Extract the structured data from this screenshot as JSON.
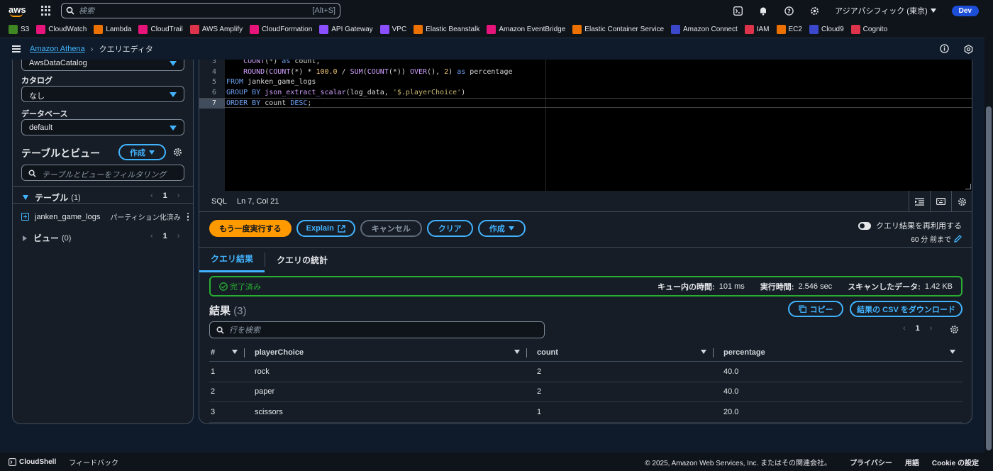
{
  "topnav": {
    "logo": "aws",
    "search_placeholder": "検索",
    "search_shortcut": "[Alt+S]",
    "region": "アジアパシフィック (東京)",
    "account_badge": "Dev"
  },
  "favorites": [
    {
      "label": "S3",
      "color": "#3f8624"
    },
    {
      "label": "CloudWatch",
      "color": "#e7157b"
    },
    {
      "label": "Lambda",
      "color": "#ed7100"
    },
    {
      "label": "CloudTrail",
      "color": "#e7157b"
    },
    {
      "label": "AWS Amplify",
      "color": "#dd344c"
    },
    {
      "label": "CloudFormation",
      "color": "#e7157b"
    },
    {
      "label": "API Gateway",
      "color": "#8c4fff"
    },
    {
      "label": "VPC",
      "color": "#8c4fff"
    },
    {
      "label": "Elastic Beanstalk",
      "color": "#ed7100"
    },
    {
      "label": "Amazon EventBridge",
      "color": "#e7157b"
    },
    {
      "label": "Elastic Container Service",
      "color": "#ed7100"
    },
    {
      "label": "Amazon Connect",
      "color": "#3b48cc"
    },
    {
      "label": "IAM",
      "color": "#dd344c"
    },
    {
      "label": "EC2",
      "color": "#ed7100"
    },
    {
      "label": "Cloud9",
      "color": "#3b48cc"
    },
    {
      "label": "Cognito",
      "color": "#dd344c"
    }
  ],
  "breadcrumb": {
    "service": "Amazon Athena",
    "current": "クエリエディタ"
  },
  "left": {
    "datasource_value": "AwsDataCatalog",
    "catalog_label": "カタログ",
    "catalog_value": "なし",
    "database_label": "データベース",
    "database_value": "default",
    "tables_views_title": "テーブルとビュー",
    "create_label": "作成",
    "filter_placeholder": "テーブルとビューをフィルタリング",
    "tables_label": "テーブル",
    "tables_count": "(1)",
    "page": "1",
    "table_name": "janken_game_logs",
    "table_partition": "パーティション化済み",
    "views_label": "ビュー",
    "views_count": "(0)",
    "views_page": "1"
  },
  "editor": {
    "lines": [
      {
        "n": "3",
        "code": "    COUNT(*) as count,"
      },
      {
        "n": "4",
        "code": "    ROUND(COUNT(*) * 100.0 / SUM(COUNT(*)) OVER(), 2) as percentage"
      },
      {
        "n": "5",
        "code": "FROM janken_game_logs"
      },
      {
        "n": "6",
        "code": "GROUP BY json_extract_scalar(log_data, '$.playerChoice')"
      },
      {
        "n": "7",
        "code": "ORDER BY count DESC;"
      }
    ],
    "lang": "SQL",
    "position": "Ln 7, Col 21"
  },
  "actions": {
    "run_again": "もう一度実行する",
    "explain": "Explain",
    "cancel": "キャンセル",
    "clear": "クリア",
    "create": "作成",
    "reuse_label": "クエリ結果を再利用する",
    "reuse_age": "60 分 前まで"
  },
  "tabs": {
    "results": "クエリ結果",
    "stats": "クエリの統計"
  },
  "status": {
    "state": "完了済み",
    "queue_label": "キュー内の時間:",
    "queue_value": "101 ms",
    "exec_label": "実行時間:",
    "exec_value": "2.546 sec",
    "scan_label": "スキャンしたデータ:",
    "scan_value": "1.42 KB"
  },
  "results": {
    "title": "結果",
    "count": "(3)",
    "copy": "コピー",
    "download": "結果の CSV をダウンロード",
    "search_placeholder": "行を検索",
    "page": "1",
    "columns": [
      "#",
      "playerChoice",
      "count",
      "percentage"
    ],
    "rows": [
      [
        "1",
        "rock",
        "2",
        "40.0"
      ],
      [
        "2",
        "paper",
        "2",
        "40.0"
      ],
      [
        "3",
        "scissors",
        "1",
        "20.0"
      ]
    ]
  },
  "footer": {
    "cloudshell": "CloudShell",
    "feedback": "フィードバック",
    "copyright": "© 2025, Amazon Web Services, Inc. またはその関連会社。",
    "privacy": "プライバシー",
    "terms": "用語",
    "cookie": "Cookie の設定"
  }
}
